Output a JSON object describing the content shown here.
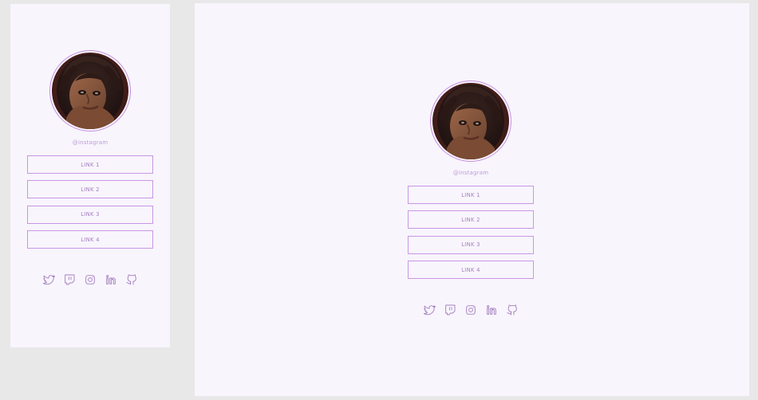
{
  "profile": {
    "handle": "@instagram",
    "links": [
      {
        "label": "LINK 1"
      },
      {
        "label": "LINK 2"
      },
      {
        "label": "LINK 3"
      },
      {
        "label": "LINK 4"
      }
    ],
    "social_icons": [
      "twitter-icon",
      "twitch-icon",
      "instagram-icon",
      "linkedin-icon",
      "github-icon"
    ]
  },
  "colors": {
    "background": "#e8e8e8",
    "panel": "#f8f5fd",
    "accent": "#c996e5",
    "handle_text": "#bc9cd4",
    "link_text": "#a57fbe"
  }
}
